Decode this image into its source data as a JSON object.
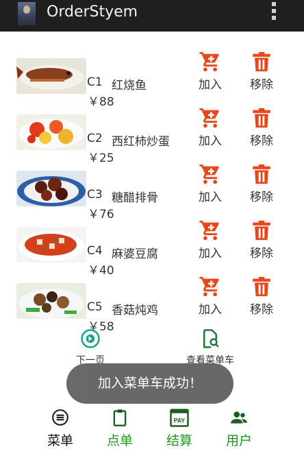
{
  "app": {
    "title": "OrderStyem"
  },
  "dishes": [
    {
      "code": "C1",
      "name": "红烧鱼",
      "price": "￥88",
      "add_label": "加入",
      "remove_label": "移除"
    },
    {
      "code": "C2",
      "name": "西红柿炒蛋",
      "price": "￥25",
      "add_label": "加入",
      "remove_label": "移除"
    },
    {
      "code": "C3",
      "name": "糖醋排骨",
      "price": "￥76",
      "add_label": "加入",
      "remove_label": "移除"
    },
    {
      "code": "C4",
      "name": "麻婆豆腐",
      "price": "￥40",
      "add_label": "加入",
      "remove_label": "移除"
    },
    {
      "code": "C5",
      "name": "香菇炖鸡",
      "price": "￥58",
      "add_label": "加入",
      "remove_label": "移除"
    }
  ],
  "actions": {
    "next_page": "下一页",
    "view_cart": "查看菜单车"
  },
  "toast": {
    "message": "加入菜单车成功！"
  },
  "tabs": [
    {
      "label": "菜单",
      "icon": "menu-icon",
      "active": false
    },
    {
      "label": "点单",
      "icon": "clipboard-icon",
      "active": true
    },
    {
      "label": "结算",
      "icon": "pay-calendar-icon",
      "active": false
    },
    {
      "label": "用户",
      "icon": "users-icon",
      "active": false
    }
  ],
  "colors": {
    "accent_red": "#e8471c",
    "tab_green": "#1e9a1e",
    "icon_dark_green": "#1b5e20",
    "teal": "#1aa58a"
  }
}
